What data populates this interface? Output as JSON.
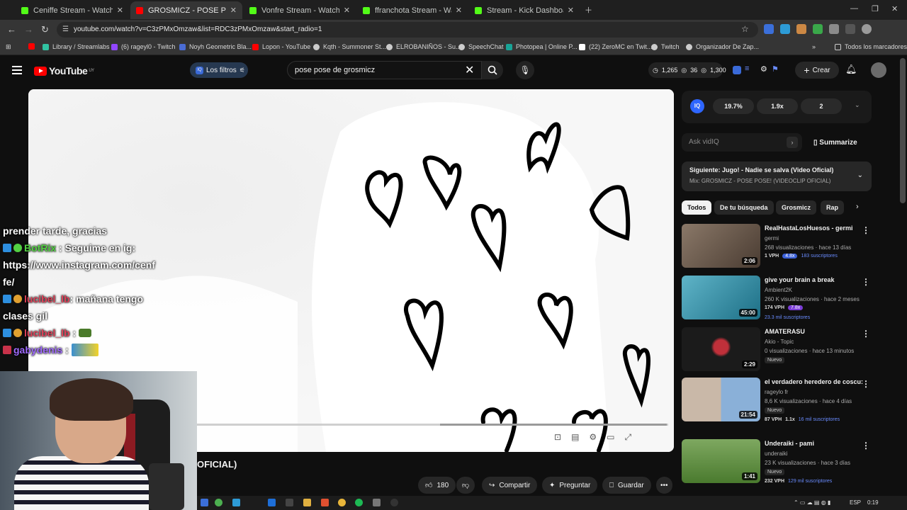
{
  "browser": {
    "tabs": [
      {
        "title": "Ceniffe Stream - Watch Live on",
        "color": "#53fc18",
        "active": false
      },
      {
        "title": "GROSMICZ - POSE POSE! (VIDE",
        "color": "#ff0000",
        "active": true
      },
      {
        "title": "Vonfre Stream - Watch Live",
        "color": "#53fc18",
        "active": false
      },
      {
        "title": "ffranchota Stream - Watch",
        "color": "#53fc18",
        "active": false
      },
      {
        "title": "Stream - Kick Dashboard",
        "color": "#53fc18",
        "active": false
      }
    ],
    "url": "youtube.com/watch?v=C3zPMxOmzaw&list=RDC3zPMxOmzaw&start_radio=1",
    "bookmarks": [
      "Library / Streamlabs",
      "(6) rageyl0 - Twitch",
      "Noyh Geometric Bla...",
      "Lopon - YouTube",
      "Kqth - Summoner St...",
      "ELROBANIÑOS - Su...",
      "SpeechChat",
      "Photopea | Online P...",
      "(22) ZeroMC en Twit...",
      "Twitch",
      "Organizador De Zap..."
    ],
    "all_bookmarks": "Todos los marcadores"
  },
  "youtube": {
    "logo": "YouTube",
    "logo_region": "UY",
    "filters_label": "Los filtros",
    "search_query": "pose pose de grosmicz",
    "header_stats": [
      "1,265",
      "36",
      "1,300"
    ],
    "create_label": "Crear",
    "video_title_fragment": "OFICIAL)",
    "likes": "180",
    "actions": [
      "Compartir",
      "Preguntar",
      "Guardar"
    ]
  },
  "chat": {
    "lines": [
      {
        "text": "prender tarde, gracias"
      },
      {
        "user": "BotRix",
        "text": ": Seguime en ig:"
      },
      {
        "text": "https://www.instagram.com/cenf"
      },
      {
        "text": "fe/"
      },
      {
        "user": "lucibel_lb",
        "text": ": mañana tengo"
      },
      {
        "text": "clases gil"
      },
      {
        "user": "lucibel_lb",
        "text": ":"
      },
      {
        "user": "gabydenis",
        "text": ":"
      }
    ]
  },
  "vidiq": {
    "logo": "IQ",
    "metrics": [
      "19.7%",
      "1.9x",
      "2"
    ],
    "ask_placeholder": "Ask vidIQ",
    "summarize": "Summarize"
  },
  "up_next": {
    "title": "Siguiente: Jugo! - Nadie se salva (Video Oficial)",
    "sub": "Mix: GROSMICZ - POSE POSE! (VIDEOCLIP OFICIAL)"
  },
  "chips": [
    "Todos",
    "De tu búsqueda",
    "Grosmicz",
    "Rap"
  ],
  "recommendations": [
    {
      "title": "RealHastaLosHuesos - germi",
      "channel": "germi",
      "meta": "268 visualizaciones · hace 13 días",
      "duration": "2:06",
      "vph": "1 VPH",
      "mult": "4.8x",
      "subs": "183 suscriptores",
      "thumb": "#7a6a5e",
      "nuevo": ""
    },
    {
      "title": "give your brain a break",
      "channel": "Ambient2K",
      "meta": "260 K visualizaciones · hace 2 meses",
      "duration": "45:00",
      "vph": "174 VPH",
      "mult": "7.8x",
      "subs": "23.3 mil suscriptores",
      "thumb": "#2e8fa6",
      "nuevo": ""
    },
    {
      "title": "AMATERASU",
      "channel": "Akio - Topic",
      "meta": "0 visualizaciones · hace 13 minutos",
      "duration": "2:29",
      "vph": "",
      "mult": "",
      "subs": "",
      "thumb": "#1b1b1b",
      "nuevo": "Nuevo"
    },
    {
      "title": "el verdadero heredero de coscu:",
      "channel": "rageylo fr",
      "meta": "8,6 K visualizaciones · hace 4 días",
      "duration": "21:54",
      "vph": "87 VPH",
      "mult": "1.1x",
      "subs": "16 mil suscriptores",
      "thumb": "#6d8fb0",
      "nuevo": "Nuevo"
    },
    {
      "title": "Underaiki - pami",
      "channel": "underaiki",
      "meta": "23 K visualizaciones · hace 3 días",
      "duration": "1:41",
      "vph": "232 VPH",
      "mult": "",
      "subs": "129 mil suscriptores",
      "thumb": "#5f8a3e",
      "nuevo": "Nuevo"
    }
  ],
  "taskbar": {
    "lang": "ESP",
    "time": "0:19"
  }
}
